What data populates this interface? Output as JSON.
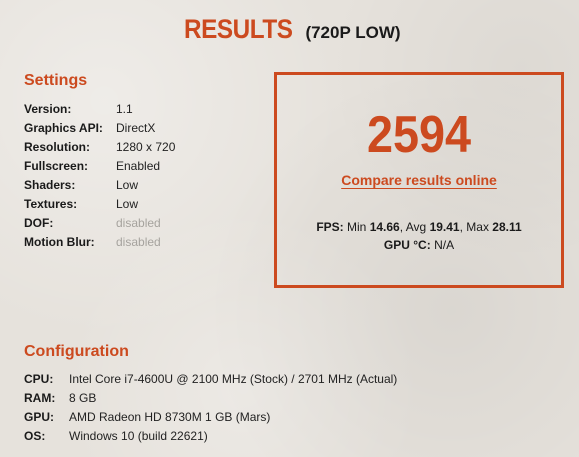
{
  "header": {
    "title": "RESULTS",
    "subtitle": "(720P LOW)"
  },
  "settings": {
    "title": "Settings",
    "rows": [
      {
        "label": "Version:",
        "value": "1.1"
      },
      {
        "label": "Graphics API:",
        "value": "DirectX"
      },
      {
        "label": "Resolution:",
        "value": "1280 x 720"
      },
      {
        "label": "Fullscreen:",
        "value": "Enabled"
      },
      {
        "label": "Shaders:",
        "value": "Low"
      },
      {
        "label": "Textures:",
        "value": "Low"
      },
      {
        "label": "DOF:",
        "value": "disabled"
      },
      {
        "label": "Motion Blur:",
        "value": "disabled"
      }
    ]
  },
  "results": {
    "score": "2594",
    "compare_label": "Compare results online",
    "fps_label": "FPS:",
    "min_label": "Min",
    "min_value": "14.66",
    "avg_label": "Avg",
    "avg_value": "19.41",
    "max_label": "Max",
    "max_value": "28.11",
    "gpu_temp_label": "GPU °C:",
    "gpu_temp_value": "N/A"
  },
  "configuration": {
    "title": "Configuration",
    "rows": [
      {
        "label": "CPU:",
        "value": "Intel Core i7-4600U @ 2100 MHz (Stock) / 2701 MHz (Actual)"
      },
      {
        "label": "RAM:",
        "value": "8 GB"
      },
      {
        "label": "GPU:",
        "value": "AMD Radeon HD 8730M 1 GB (Mars)"
      },
      {
        "label": "OS:",
        "value": "Windows 10 (build 22621)"
      }
    ]
  },
  "colors": {
    "accent": "#cc4a1f",
    "background": "#e6e2dc",
    "muted_text": "#a6a39e"
  }
}
